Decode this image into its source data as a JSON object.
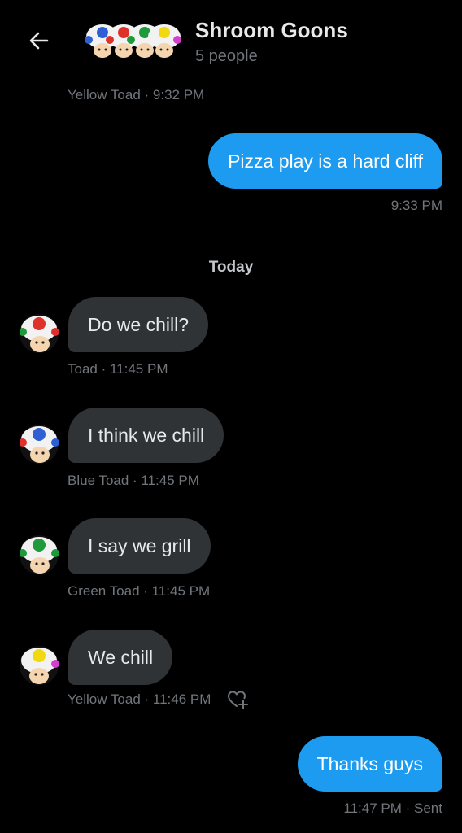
{
  "header": {
    "title": "Shroom Goons",
    "subtitle": "5 people"
  },
  "colors": {
    "accent": "#1d9bf0",
    "incoming_bubble": "#2f3336",
    "muted": "#71767b",
    "background": "#000000"
  },
  "messages": [
    {
      "direction": "in",
      "text": "Pizza play is a hard cliff",
      "meta": "9:33 PM"
    },
    {
      "direction": "in",
      "text": "Do we chill?",
      "meta": "Toad · 11:45 PM",
      "avatar": "red-toad-icon"
    },
    {
      "direction": "in",
      "text": "I think we chill",
      "meta": "Blue Toad · 11:45 PM",
      "avatar": "blue-toad-icon"
    },
    {
      "direction": "in",
      "text": "I say we grill",
      "meta": "Green Toad · 11:45 PM",
      "avatar": "green-toad-icon"
    },
    {
      "direction": "in",
      "text": "We chill",
      "meta": "Yellow Toad · 11:46 PM",
      "avatar": "yellow-toad-icon"
    },
    {
      "direction": "out",
      "text": "Thanks guys",
      "meta": "11:47 PM · Sent"
    }
  ],
  "earlier_meta": "Yellow Toad · 9:32 PM",
  "day_separator": "Today"
}
